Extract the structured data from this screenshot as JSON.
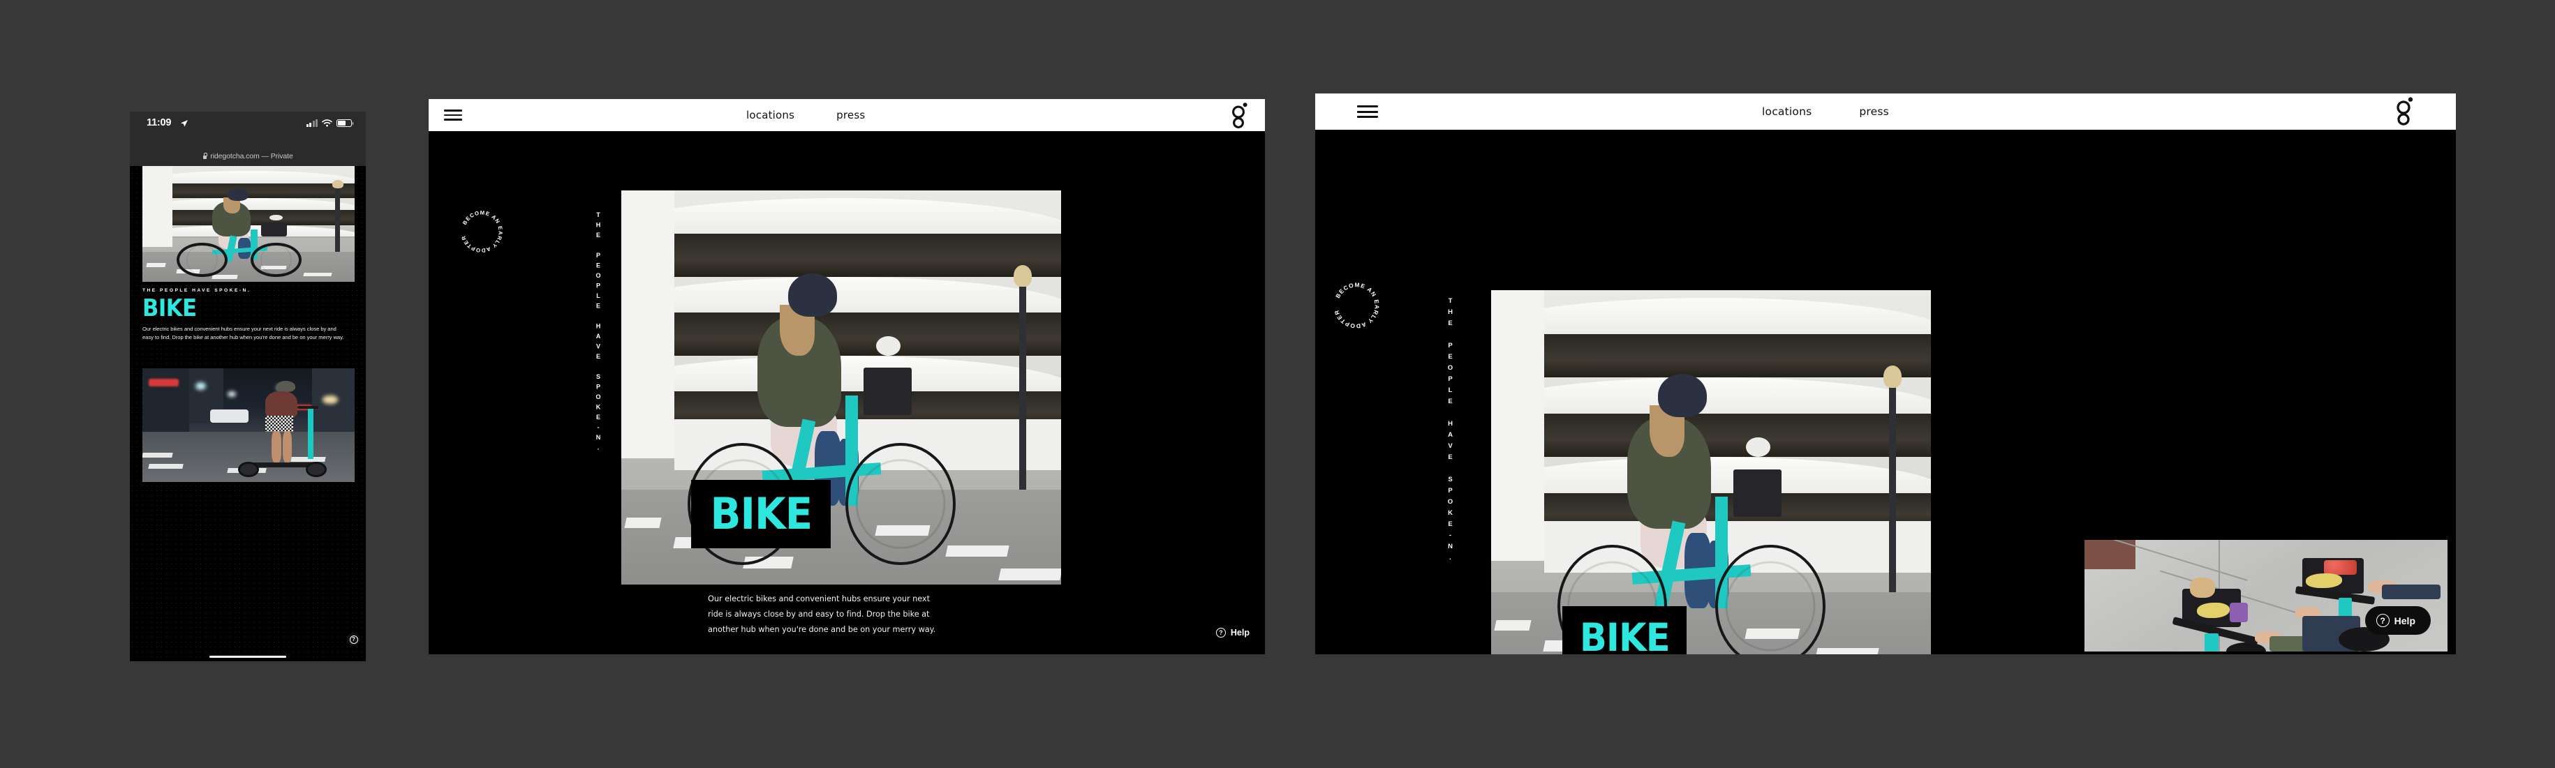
{
  "page": {
    "background_color": "#383838",
    "accent_color": "#2EE8E0",
    "surface_dark": "#000000",
    "surface_light": "#ffffff"
  },
  "mobile": {
    "status_bar": {
      "time": "11:09",
      "location_icon": "location-arrow-icon",
      "signal_icon": "cellular-signal-icon",
      "wifi_icon": "wifi-icon",
      "battery_icon": "battery-icon"
    },
    "url_bar": {
      "lock_icon": "lock-icon",
      "text": "ridegotcha.com — Private"
    },
    "eyebrow": "THE PEOPLE HAVE SPOKE-N.",
    "heading": "BIKE",
    "body": "Our electric bikes and convenient hubs ensure your next ride is always close by and easy to find. Drop the bike at another hub when you're done and be on your merry way.",
    "hero_photo_alt": "woman riding teal electric bike past parking garage",
    "secondary_photo_alt": "person riding electric scooter on city street at night",
    "help_icon": "question-circle-icon",
    "home_indicator": "home-indicator"
  },
  "tablet": {
    "header": {
      "menu_icon": "hamburger-menu-icon",
      "nav": [
        {
          "label": "locations"
        },
        {
          "label": "press"
        }
      ],
      "logo_icon": "gotcha-double-ring-logo"
    },
    "badge_text": "BECOME AN EARLY ADOPTER",
    "vertical_eyebrow": "THE PEOPLE HAVE SPOKE-N.",
    "heading": "BIKE",
    "body": "Our electric bikes and convenient hubs ensure your next ride is always close by and easy to find. Drop the bike at another hub when you're done and be on your merry way.",
    "hero_photo_alt": "woman riding teal electric bike past parking garage",
    "help": {
      "label": "Help",
      "icon": "question-circle-icon"
    }
  },
  "desktop": {
    "header": {
      "menu_icon": "hamburger-menu-icon",
      "nav": [
        {
          "label": "locations"
        },
        {
          "label": "press"
        }
      ],
      "logo_icon": "gotcha-double-ring-logo"
    },
    "badge_text": "BECOME AN EARLY ADOPTER",
    "vertical_eyebrow": "THE PEOPLE HAVE SPOKE-N.",
    "heading": "BIKE",
    "hero_photo_alt": "woman riding teal electric bike past parking garage",
    "secondary_photo_alt": "overhead view of two cyclists with groceries in bike baskets",
    "help": {
      "label": "Help",
      "icon": "question-circle-icon"
    }
  }
}
